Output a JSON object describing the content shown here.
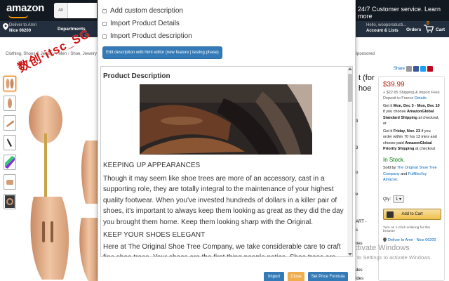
{
  "header": {
    "logo": "amazon",
    "search_category": "All",
    "customer_service": "24/7 Customer service. Learn more",
    "deliver_line1": "Deliver to Amri",
    "deliver_line2": "Nice 06200",
    "departments": "Departments",
    "hello_line1": "Hello, woopsroducti...",
    "hello_line2": "Account & Lists",
    "orders": "Orders",
    "cart": "Cart",
    "cart_count": "0"
  },
  "breadcrumb": "Clothing, Shoes & Jewelry › Men › Shoe, Jewelry & Watch Accessories",
  "breadcrumb_right": "Sponsored",
  "watermark": "数创·itsc_SG",
  "title_fragment": [
    "t (for",
    "hoe"
  ],
  "side_fragments": [
    "3",
    "3",
    "o",
    "e",
    "ART -",
    "s",
    "oes",
    "des",
    "ides"
  ],
  "buybox": {
    "share": "Share",
    "price": "$39.99",
    "shipping": "+ $22.65 Shipping & Import Fees Deposit to France",
    "details": "Details",
    "delivery1_a": "Get it",
    "delivery1_b": "Mon, Dec 3 - Mon, Dec 10",
    "delivery1_c": "if you choose",
    "delivery1_d": "AmazonGlobal Standard Shipping",
    "delivery1_e": "at checkout, or",
    "delivery2_a": "Get it",
    "delivery2_b": "Friday, Nov. 23",
    "delivery2_c": "if you order within 70 hrs 13 mins and choose paid",
    "delivery2_d": "AmazonGlobal Priority Shipping",
    "delivery2_e": "at checkout",
    "in_stock": "In Stock.",
    "sold_by": "Sold by",
    "seller": "The Original Shoe Tree Company",
    "and": "and",
    "fulfilled": "Fulfilled by Amazon.",
    "qty_label": "Qty:",
    "qty_value": "1",
    "add_to_cart": "Add to Cart",
    "turn_on_1click": "Turn on 1-Click ordering for this browser",
    "deliver_to": "Deliver to Amri - Nice 06200"
  },
  "activate": {
    "title": "Activate Windows",
    "sub": "Go to Settings to activate Windows."
  },
  "modal": {
    "opt1": "Add custom description",
    "opt2": "Import Product Details",
    "opt3": "Import Product description",
    "edit_button": "Edit description with html editor (new feature | testing phase)",
    "desc_title": "Product Description",
    "h1": "KEEPING UP APPEARANCES",
    "p1": "Though it may seem like shoe trees are more of an accessory, cast in a supporting role, they are totally integral to the maintenance of your highest quality footwear. When you've invested hundreds of dollars in a killer pair of shoes, it's important to always keep them looking as great as they did the day you brought them home. Keep them looking sharp with the Original.",
    "h2": "KEEP YOUR SHOES ELEGANT",
    "p2": "Here at The Original Shoe Tree Company, we take considerable care to craft fine shoe trees. Your shoes are the first thing people notice. Shoe trees are the meaningful and",
    "btn_import": "Import",
    "btn_close": "Close",
    "btn_formula": "Set Price Formula"
  }
}
